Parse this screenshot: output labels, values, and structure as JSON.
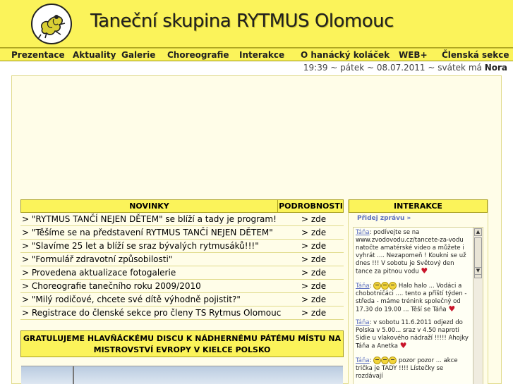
{
  "header": {
    "title": "Taneční skupina RYTMUS Olomouc",
    "logo_icon": "dancer-logo-icon"
  },
  "nav": {
    "items": [
      {
        "label": "Prezentace"
      },
      {
        "label": "Aktuality"
      },
      {
        "label": "Galerie"
      },
      {
        "label": "Choreografie"
      },
      {
        "label": "Interakce"
      },
      {
        "label": "O hanácký koláček"
      },
      {
        "label": "WEB+"
      },
      {
        "label": "Členská sekce"
      }
    ]
  },
  "datebar": {
    "text": "19:39 ~ pátek ~ 08.07.2011 ~ svátek má",
    "name": "Nora"
  },
  "news": {
    "header_title": "NOVINKY",
    "header_details": "PODROBNOSTI",
    "rows": [
      {
        "text": "> \"RYTMUS TANČÍ NEJEN DĚTEM\" se blíží a tady je program!",
        "link": "> zde"
      },
      {
        "text": "> \"Těšíme se na představení RYTMUS TANČÍ NEJEN DĚTEM\"",
        "link": "> zde"
      },
      {
        "text": "> \"Slavíme 25 let a blíží se sraz bývalých rytmusáků!!!\"",
        "link": "> zde"
      },
      {
        "text": "> \"Formulář zdravotní způsobilosti\"",
        "link": "> zde"
      },
      {
        "text": "> Provedena aktualizace fotogalerie",
        "link": "> zde"
      },
      {
        "text": "> Choreografie tanečního roku 2009/2010",
        "link": "> zde"
      },
      {
        "text": "> \"Milý rodičové, chcete své dítě výhodně pojistit?\"",
        "link": "> zde"
      },
      {
        "text": "> Registrace do členské sekce pro členy TS Rytmus Olomouc",
        "link": "> zde"
      }
    ]
  },
  "congrats": {
    "line1": "GRATULUJEME HLAVŇÁCKÉMU DISCU K NÁDHERNÉMU PÁTÉMU MÍSTU NA",
    "line2": "MISTROVSTVÍ EVROPY V KIELCE POLSKO"
  },
  "interakce": {
    "title": "INTERAKCE",
    "add_label": "Přidej zprávu »",
    "messages": [
      {
        "author": "Táňa",
        "text": ": podívejte se na www.zvodovodu.cz/tancete-za-vodu natočte amatérské video a můžete i vyhrát .... Nezapomeň ! Koukni se už dnes !!! V sobotu je Světový den tance za pitnou vodu"
      },
      {
        "author": "Táňa",
        "text": "Halo halo ... Vodáci a chobotničáci .... tento a příští týden - středa - máme trénink společný od 17.30 do 19.00 ... Těší se Táňa"
      },
      {
        "author": "Táňa",
        "text": ": v sobotu 11.6.2011 odjezd do Polska v 5.00... sraz v 4.50 naproti Sidie u vlakového nádraží !!!!! Ahojky Táňa a Anetka"
      },
      {
        "author": "Táňa",
        "text": "pozor pozor ... akce trička je TADY !!!! Lístečky se rozdávají"
      }
    ]
  },
  "colors": {
    "header_yellow": "#fbf35a",
    "border_olive": "#a89f1c",
    "link_blue": "#5c6fbf"
  }
}
